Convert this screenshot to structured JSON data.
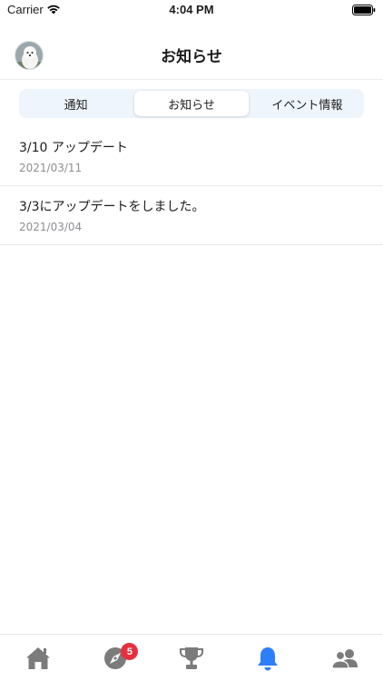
{
  "status_bar": {
    "carrier": "Carrier",
    "time": "4:04 PM"
  },
  "nav": {
    "title": "お知らせ"
  },
  "segments": [
    {
      "label": "通知",
      "active": false
    },
    {
      "label": "お知らせ",
      "active": true
    },
    {
      "label": "イベント情報",
      "active": false
    }
  ],
  "news": [
    {
      "title": "3/10 アップデート",
      "date": "2021/03/11"
    },
    {
      "title": "3/3にアップデートをしました。",
      "date": "2021/03/04"
    }
  ],
  "tab_bar": {
    "active_color": "#2d7ff9",
    "inactive_color": "#7b7b7b",
    "tabs": [
      {
        "icon": "home-icon"
      },
      {
        "icon": "compass-icon",
        "badge": "5"
      },
      {
        "icon": "trophy-icon"
      },
      {
        "icon": "bell-icon",
        "active": true
      },
      {
        "icon": "people-icon"
      }
    ]
  }
}
